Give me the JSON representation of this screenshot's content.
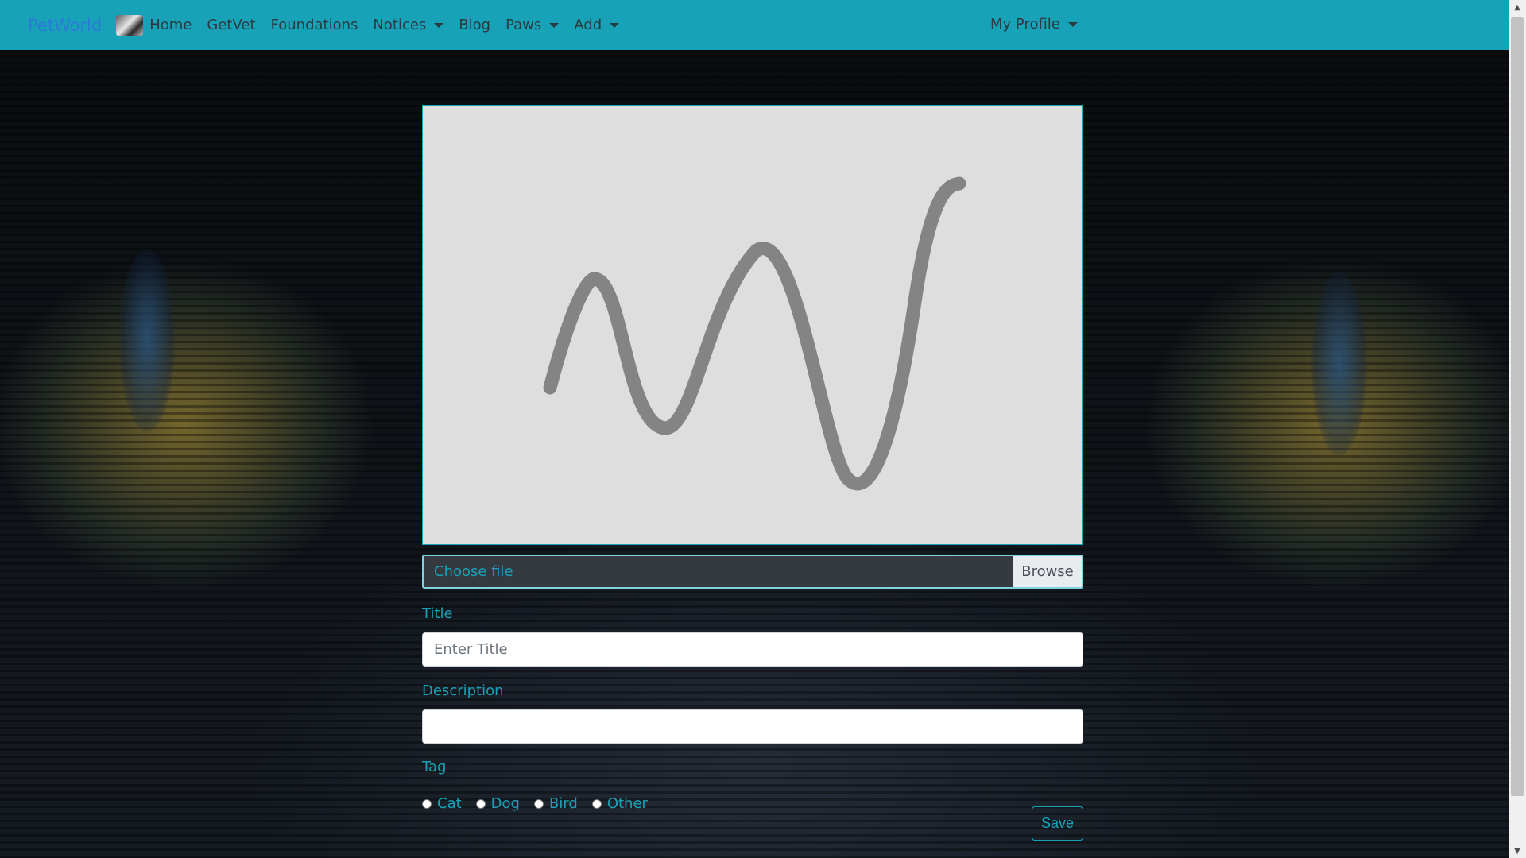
{
  "navbar": {
    "brand": "PetWorld",
    "items": [
      {
        "label": "Home",
        "dropdown": false
      },
      {
        "label": "GetVet",
        "dropdown": false
      },
      {
        "label": "Foundations",
        "dropdown": false
      },
      {
        "label": "Notices",
        "dropdown": true
      },
      {
        "label": "Blog",
        "dropdown": false
      },
      {
        "label": "Paws",
        "dropdown": true
      },
      {
        "label": "Add",
        "dropdown": true
      }
    ],
    "profile": "My Profile"
  },
  "form": {
    "file": {
      "label": "Choose file",
      "button": "Browse"
    },
    "title": {
      "label": "Title",
      "placeholder": "Enter Title"
    },
    "description": {
      "label": "Description",
      "placeholder": ""
    },
    "tag": {
      "label": "Tag",
      "options": [
        "Cat",
        "Dog",
        "Bird",
        "Other"
      ]
    },
    "save_label": "Save"
  },
  "colors": {
    "accent": "#17a2b8",
    "brand": "#2a7bd6",
    "preview_bg": "#dedede",
    "file_bg": "#343a40"
  },
  "icons": {
    "preview": "image-placeholder-icon",
    "avatar": "user-avatar"
  }
}
